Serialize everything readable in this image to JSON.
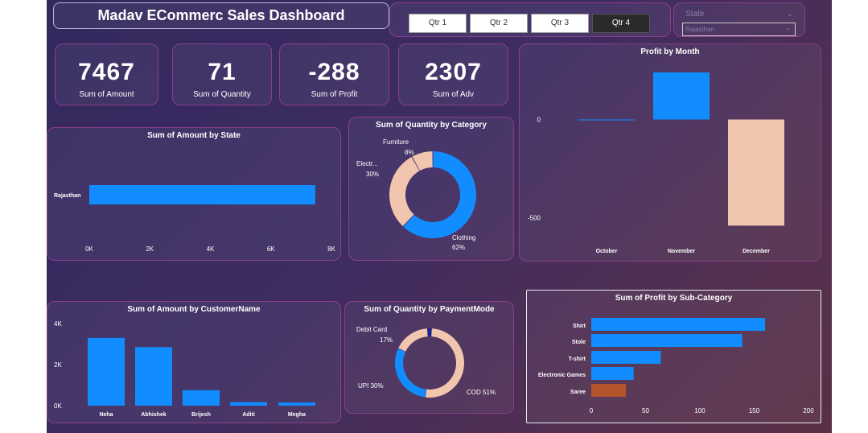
{
  "header": {
    "title": "Madav ECommerc Sales Dashboard"
  },
  "quarters": {
    "items": [
      "Qtr 1",
      "Qtr 2",
      "Qtr 3",
      "Qtr 4"
    ],
    "selected": "Qtr 4"
  },
  "state_filter": {
    "label": "State",
    "value": "Rajasthan"
  },
  "kpis": [
    {
      "value": "7467",
      "label": "Sum of Amount"
    },
    {
      "value": "71",
      "label": "Sum of Quantity"
    },
    {
      "value": "-288",
      "label": "Sum of Profit"
    },
    {
      "value": "2307",
      "label": "Sum of Adv"
    }
  ],
  "colors": {
    "blue": "#118dff",
    "peach": "#f2c5ae",
    "navy": "#12239e",
    "rust": "#b5542c",
    "border": "#8a3f8c"
  },
  "chart_data": [
    {
      "id": "profit_by_month",
      "type": "bar",
      "title": "Profit by Month",
      "categories": [
        "October",
        "November",
        "December"
      ],
      "values": [
        0,
        240,
        -540
      ],
      "colors": [
        "#118dff",
        "#118dff",
        "#f2c5ae"
      ],
      "y_ticks": [
        "0",
        "-500"
      ],
      "ylim": [
        -600,
        260
      ]
    },
    {
      "id": "amount_by_state",
      "type": "bar",
      "orientation": "horizontal",
      "title": "Sum of Amount by State",
      "categories": [
        "Rajasthan"
      ],
      "values": [
        7467
      ],
      "x_ticks": [
        "0K",
        "2K",
        "4K",
        "6K",
        "8K"
      ],
      "xlim": [
        0,
        8000
      ]
    },
    {
      "id": "quantity_by_category",
      "type": "pie",
      "donut": true,
      "title": "Sum of Quantity by Category",
      "labels": [
        "Clothing",
        "Electr...",
        "Furniture"
      ],
      "values": [
        62,
        30,
        8
      ],
      "percent_labels": [
        "62%",
        "30%",
        "8%"
      ],
      "colors": [
        "#118dff",
        "#f2c5ae",
        "#f2c5ae"
      ]
    },
    {
      "id": "amount_by_customer",
      "type": "bar",
      "title": "Sum of Amount by CustomerName",
      "categories": [
        "Neha",
        "Abhishek",
        "Brijesh",
        "Aditi",
        "Megha"
      ],
      "values": [
        3300,
        2850,
        750,
        170,
        150
      ],
      "y_ticks": [
        "0K",
        "2K",
        "4K"
      ],
      "ylim": [
        0,
        4000
      ]
    },
    {
      "id": "quantity_by_paymentmode",
      "type": "pie",
      "donut": true,
      "title": "Sum of Quantity by PaymentMode",
      "labels": [
        "COD",
        "UPI",
        "Debit Card",
        ""
      ],
      "values": [
        51,
        30,
        17,
        2
      ],
      "text_labels": [
        "COD 51%",
        "UPI 30%",
        "Debit Card",
        ""
      ],
      "percent_labels": [
        "",
        "",
        "17%",
        ""
      ],
      "colors": [
        "#f2c5ae",
        "#118dff",
        "#f2c5ae",
        "#12239e"
      ]
    },
    {
      "id": "profit_by_subcategory",
      "type": "bar",
      "orientation": "horizontal",
      "title": "Sum of Profit by Sub-Category",
      "categories": [
        "Shirt",
        "Stole",
        "T-shirt",
        "Electronic Games",
        "Saree"
      ],
      "values": [
        160,
        139,
        64,
        39,
        32
      ],
      "colors": [
        "#118dff",
        "#118dff",
        "#118dff",
        "#118dff",
        "#b5542c"
      ],
      "x_ticks": [
        "0",
        "50",
        "100",
        "150",
        "200"
      ],
      "xlim": [
        0,
        200
      ]
    }
  ]
}
